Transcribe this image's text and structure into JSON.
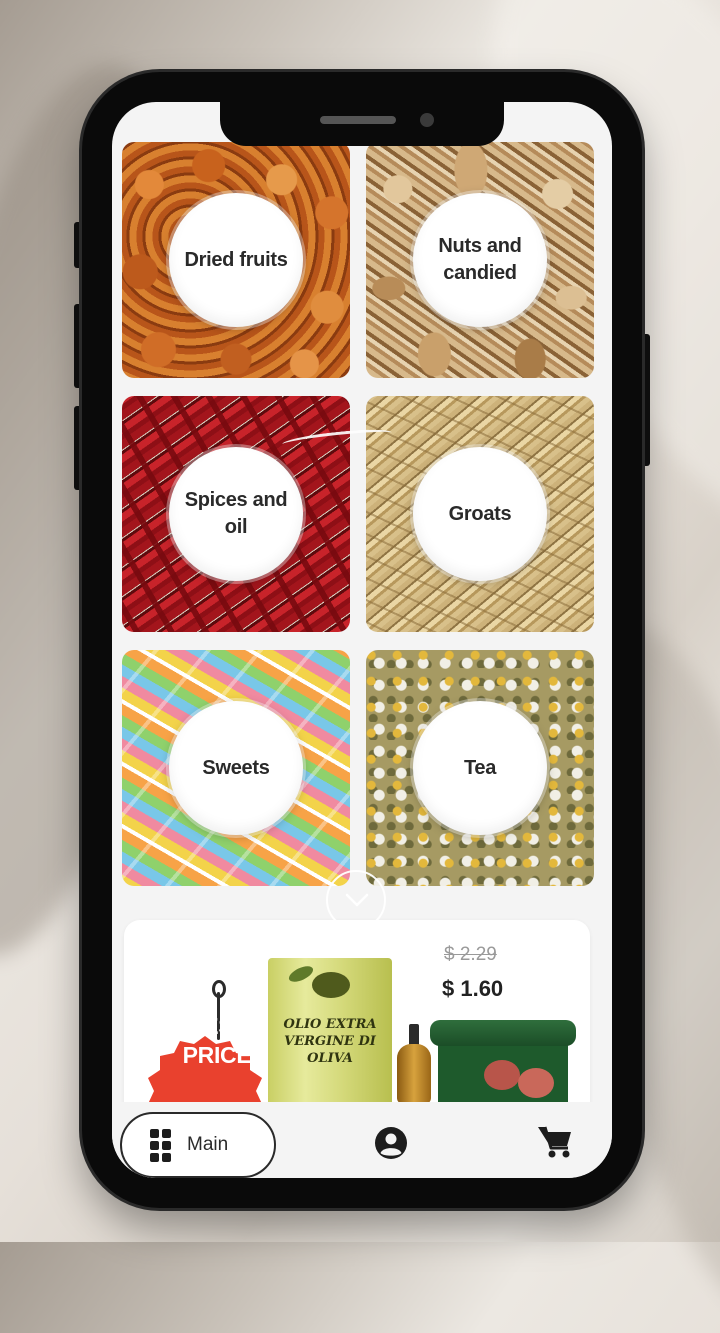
{
  "categories": [
    {
      "label": "Dried fruits",
      "icon": "dried-fruits-photo"
    },
    {
      "label": "Nuts and candied",
      "icon": "nuts-photo"
    },
    {
      "label": "Spices and oil",
      "icon": "chili-peppers-photo"
    },
    {
      "label": "Groats",
      "icon": "grains-photo"
    },
    {
      "label": "Sweets",
      "icon": "gummy-candies-photo"
    },
    {
      "label": "Tea",
      "icon": "chamomile-tea-photo"
    }
  ],
  "promo": {
    "tag_label": "BEST PRICE",
    "tag_color": "#e9412e",
    "tin_label": "OLIO EXTRA VERGINE DI OLIVA",
    "old_price": "$ 2.29",
    "new_price": "$ 1.60"
  },
  "nav": {
    "main_label": "Main",
    "profile_icon": "user-circle-icon",
    "cart_icon": "shopping-cart-icon"
  },
  "scroll_icon": "chevron-down-icon"
}
